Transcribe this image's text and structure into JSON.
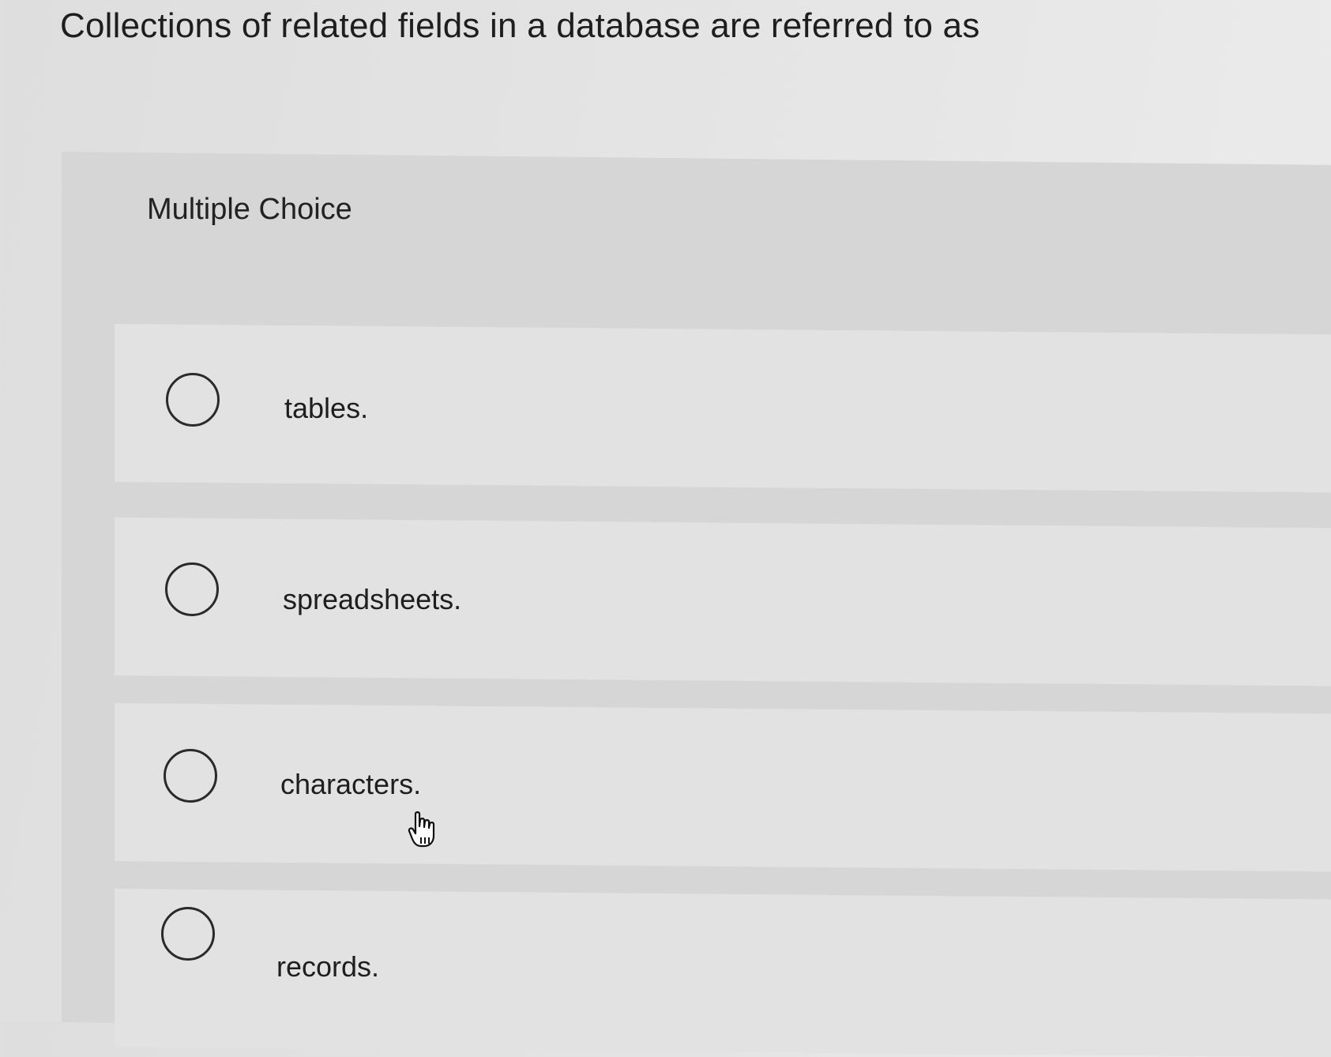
{
  "question": {
    "text": "Collections of related fields in a database are referred to as"
  },
  "card": {
    "header": "Multiple Choice"
  },
  "options": [
    {
      "label": "tables.",
      "selected": false
    },
    {
      "label": "spreadsheets.",
      "selected": false
    },
    {
      "label": "characters.",
      "selected": false
    },
    {
      "label": "records.",
      "selected": false
    }
  ],
  "cursor": {
    "icon": "pointer-hand-icon"
  }
}
